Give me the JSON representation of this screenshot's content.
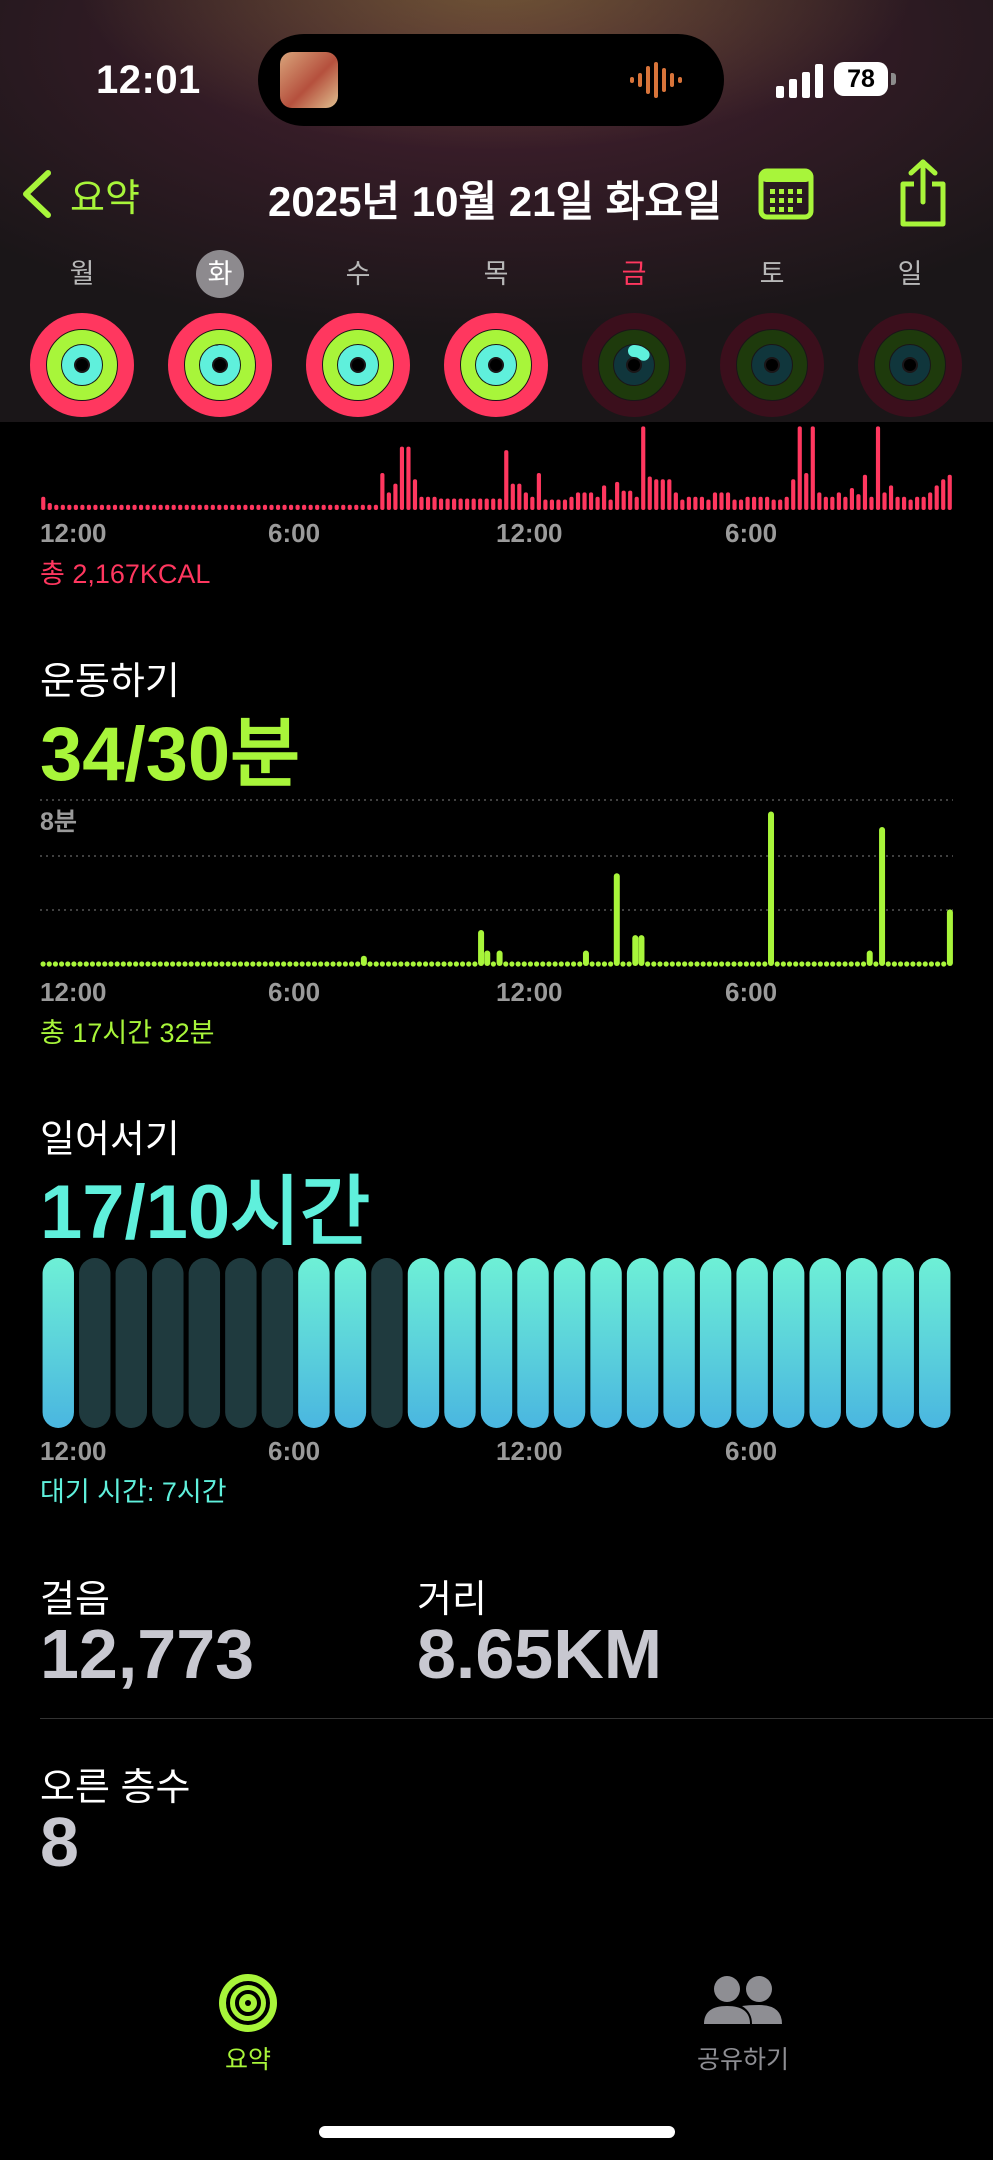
{
  "status_bar": {
    "time": "12:01",
    "battery": "78"
  },
  "nav": {
    "back_label": "요약",
    "title": "2025년 10월 21일 화요일"
  },
  "week": [
    {
      "label": "월",
      "selected": false,
      "move": 1.0,
      "exercise": 1.0,
      "stand": 1.0
    },
    {
      "label": "화",
      "selected": true,
      "move": 1.0,
      "exercise": 1.0,
      "stand": 0.95
    },
    {
      "label": "수",
      "selected": false,
      "move": 1.0,
      "exercise": 1.0,
      "stand": 1.0
    },
    {
      "label": "목",
      "selected": false,
      "move": 1.0,
      "exercise": 1.0,
      "stand": 1.0
    },
    {
      "label": "금",
      "selected": false,
      "move": 0.0,
      "exercise": 0.0,
      "stand": 0.12
    },
    {
      "label": "토",
      "selected": false,
      "move": 0.0,
      "exercise": 0.0,
      "stand": 0.0
    },
    {
      "label": "일",
      "selected": false,
      "move": 0.0,
      "exercise": 0.0,
      "stand": 0.0
    }
  ],
  "colors": {
    "move": "#ff375f",
    "exercise": "#a8f53a",
    "stand": "#5ff0dc",
    "accent": "#a8f53a",
    "stand_inactive": "#1f3a3e"
  },
  "time_ticks": [
    "12:00",
    "6:00",
    "12:00",
    "6:00"
  ],
  "move": {
    "total": "총 2,167KCAL"
  },
  "exercise": {
    "title": "운동하기",
    "value": "34/30분",
    "gridline_label": "8분",
    "total": "총 17시간 32분"
  },
  "stand": {
    "title": "일어서기",
    "value": "17/10시간",
    "idle": "대기 시간: 7시간"
  },
  "stats": {
    "steps_label": "걸음",
    "steps_value": "12,773",
    "distance_label": "거리",
    "distance_value": "8.65KM",
    "floors_label": "오른 층수",
    "floors_value": "8"
  },
  "tabbar": {
    "summary": "요약",
    "sharing": "공유하기"
  },
  "chart_data": [
    {
      "type": "bar",
      "name": "move",
      "x_ticks": [
        "12:00",
        "6:00",
        "12:00",
        "6:00"
      ],
      "values": [
        0.15,
        0.08,
        0.06,
        0.06,
        0.06,
        0.06,
        0.06,
        0.06,
        0.06,
        0.06,
        0.06,
        0.06,
        0.06,
        0.06,
        0.06,
        0.06,
        0.06,
        0.06,
        0.06,
        0.06,
        0.06,
        0.06,
        0.06,
        0.06,
        0.06,
        0.06,
        0.06,
        0.06,
        0.06,
        0.06,
        0.06,
        0.06,
        0.06,
        0.06,
        0.06,
        0.06,
        0.06,
        0.06,
        0.06,
        0.06,
        0.06,
        0.06,
        0.06,
        0.06,
        0.06,
        0.06,
        0.06,
        0.06,
        0.06,
        0.06,
        0.06,
        0.06,
        0.42,
        0.2,
        0.3,
        0.72,
        0.72,
        0.35,
        0.15,
        0.15,
        0.15,
        0.13,
        0.13,
        0.13,
        0.13,
        0.13,
        0.13,
        0.13,
        0.13,
        0.13,
        0.13,
        0.68,
        0.3,
        0.3,
        0.2,
        0.15,
        0.42,
        0.12,
        0.12,
        0.12,
        0.12,
        0.15,
        0.2,
        0.2,
        0.2,
        0.15,
        0.28,
        0.12,
        0.32,
        0.22,
        0.22,
        0.15,
        0.95,
        0.38,
        0.35,
        0.35,
        0.35,
        0.2,
        0.12,
        0.15,
        0.15,
        0.15,
        0.12,
        0.2,
        0.2,
        0.2,
        0.12,
        0.12,
        0.15,
        0.15,
        0.15,
        0.15,
        0.12,
        0.12,
        0.15,
        0.35,
        0.95,
        0.42,
        0.95,
        0.2,
        0.15,
        0.15,
        0.2,
        0.15,
        0.25,
        0.18,
        0.4,
        0.15,
        0.95,
        0.2,
        0.28,
        0.15,
        0.15,
        0.12,
        0.15,
        0.15,
        0.2,
        0.28,
        0.35,
        0.4
      ]
    },
    {
      "type": "bar",
      "name": "exercise",
      "x_ticks": [
        "12:00",
        "6:00",
        "12:00",
        "6:00"
      ],
      "ylabel": "",
      "gridline": "8분",
      "values": [
        0,
        0,
        0,
        0,
        0,
        0,
        0,
        0,
        0,
        0,
        0,
        0,
        0,
        0,
        0,
        0,
        0,
        0,
        0,
        0,
        0,
        0,
        0,
        0,
        0,
        0,
        0,
        0,
        0,
        0,
        0,
        0,
        0,
        0,
        0,
        0,
        0,
        0,
        0,
        0,
        0,
        0,
        0,
        0,
        0,
        0,
        0,
        0,
        0,
        0,
        0,
        0,
        1,
        0,
        0,
        0,
        0,
        0,
        0,
        0,
        0,
        0,
        0,
        0,
        0,
        0,
        0,
        0,
        0,
        0,
        0,
        3.5,
        1.5,
        0,
        1.5,
        0,
        0,
        0,
        0,
        0,
        0,
        0,
        0,
        0,
        0,
        0,
        0,
        0,
        1.5,
        0,
        0,
        0,
        0,
        9,
        0,
        0,
        3,
        3,
        0,
        0,
        0,
        0,
        0,
        0,
        0,
        0,
        0,
        0,
        0,
        0,
        0,
        0,
        0,
        0,
        0,
        0,
        0,
        0,
        15,
        0,
        0,
        0,
        0,
        0,
        0,
        0,
        0,
        0,
        0,
        0,
        0,
        0,
        0,
        0,
        1.5,
        0,
        13.5,
        0,
        0,
        0,
        0,
        0,
        0,
        0,
        0,
        0,
        0,
        5.5
      ]
    },
    {
      "type": "bar",
      "name": "stand",
      "x_ticks": [
        "12:00",
        "6:00",
        "12:00",
        "6:00"
      ],
      "hours_stood": [
        true,
        false,
        false,
        false,
        false,
        false,
        false,
        true,
        true,
        false,
        true,
        true,
        true,
        true,
        true,
        true,
        true,
        true,
        true,
        true,
        true,
        true,
        true,
        true,
        true
      ]
    }
  ]
}
